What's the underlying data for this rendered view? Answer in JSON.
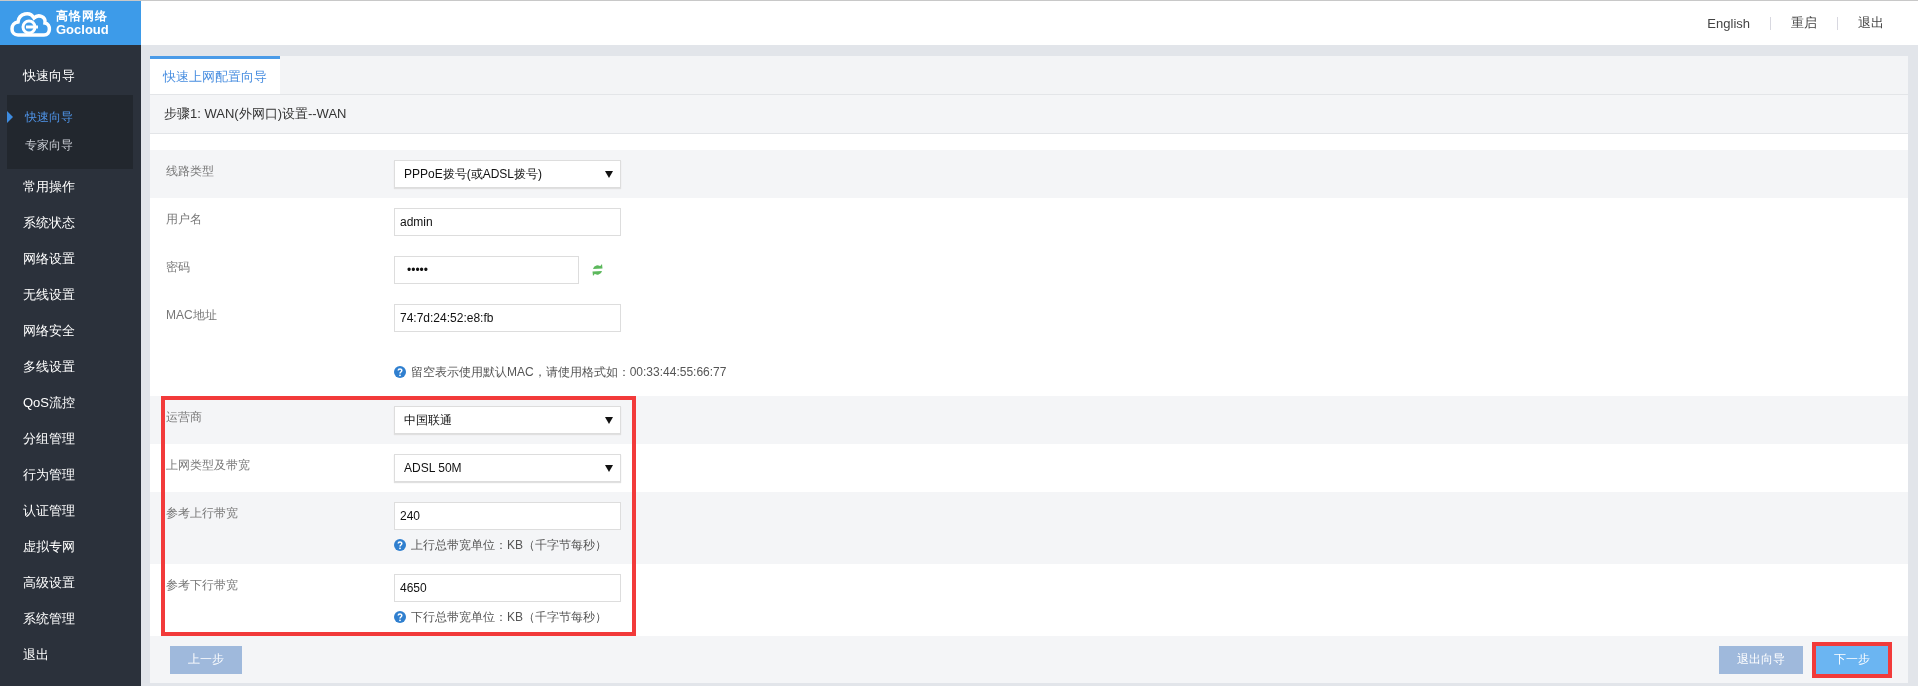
{
  "header": {
    "logo": {
      "name": "高恪网络",
      "brand": "Gocloud"
    },
    "links": [
      "English",
      "重启",
      "退出"
    ]
  },
  "sidebar": {
    "items": [
      {
        "label": "快速向导",
        "children": [
          {
            "label": "快速向导",
            "selected": true
          },
          {
            "label": "专家向导",
            "selected": false
          }
        ]
      },
      {
        "label": "常用操作"
      },
      {
        "label": "系统状态"
      },
      {
        "label": "网络设置"
      },
      {
        "label": "无线设置"
      },
      {
        "label": "网络安全"
      },
      {
        "label": "多线设置"
      },
      {
        "label": "QoS流控"
      },
      {
        "label": "分组管理"
      },
      {
        "label": "行为管理"
      },
      {
        "label": "认证管理"
      },
      {
        "label": "虚拟专网"
      },
      {
        "label": "高级设置"
      },
      {
        "label": "系统管理"
      },
      {
        "label": "退出"
      }
    ]
  },
  "tabs": [
    {
      "label": "快速上网配置向导",
      "selected": true
    }
  ],
  "step_title": "步骤1: WAN(外网口)设置--WAN",
  "form": {
    "groups": [
      {
        "highlighted": false,
        "rows": [
          {
            "kind": "select",
            "label": "线路类型",
            "value": "PPPoE拨号(或ADSL拨号)"
          },
          {
            "kind": "text",
            "label": "用户名",
            "value": "admin"
          },
          {
            "kind": "password",
            "label": "密码",
            "value": "•••••"
          },
          {
            "kind": "text",
            "label": "MAC地址",
            "value": "74:7d:24:52:e8:fb"
          },
          {
            "kind": "note",
            "hint": "留空表示使用默认MAC，请使用格式如：00:33:44:55:66:77"
          }
        ]
      },
      {
        "highlighted": true,
        "rows": [
          {
            "kind": "select",
            "label": "运营商",
            "value": "中国联通"
          },
          {
            "kind": "select",
            "label": "上网类型及带宽",
            "value": "ADSL 50M"
          },
          {
            "kind": "text",
            "label": "参考上行带宽",
            "value": "240",
            "hint": "上行总带宽单位：KB（千字节每秒）"
          },
          {
            "kind": "text",
            "label": "参考下行带宽",
            "value": "4650",
            "hint": "下行总带宽单位：KB（千字节每秒）"
          }
        ]
      }
    ]
  },
  "footer": {
    "left_buttons": [
      {
        "label": "上一步",
        "disabled": true,
        "highlighted": false
      }
    ],
    "right_buttons": [
      {
        "label": "退出向导",
        "disabled": true,
        "highlighted": false
      },
      {
        "label": "下一步",
        "disabled": false,
        "highlighted": true
      }
    ]
  }
}
